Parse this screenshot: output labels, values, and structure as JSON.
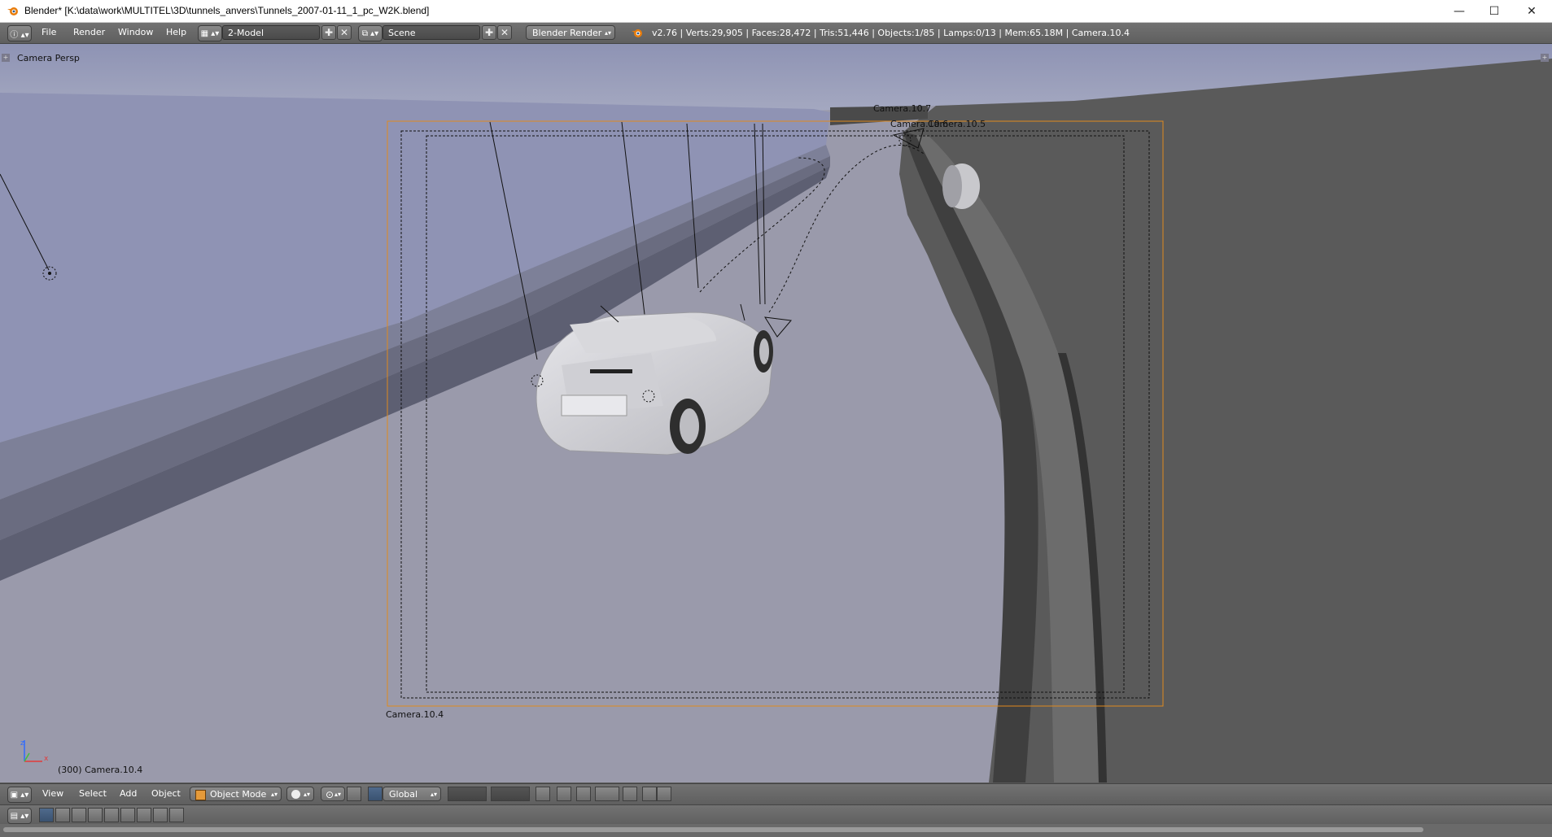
{
  "window": {
    "title": "Blender* [K:\\data\\work\\MULTITEL\\3D\\tunnels_anvers\\Tunnels_2007-01-11_1_pc_W2K.blend]",
    "controls": {
      "minimize": "—",
      "maximize": "☐",
      "close": "✕"
    }
  },
  "info_header": {
    "editor_type_icon": "info-icon",
    "menus": [
      "File",
      "Render",
      "Window",
      "Help"
    ],
    "layout": {
      "icon": "screen-layout-icon",
      "value": "2-Model"
    },
    "scene": {
      "icon": "scene-icon",
      "value": "Scene"
    },
    "render_engine": "Blender Render",
    "stats": "v2.76 | Verts:29,905 | Faces:28,472 | Tris:51,446 | Objects:1/85 | Lamps:0/13 | Mem:65.18M | Camera.10.4"
  },
  "viewport": {
    "view_name": "Camera Persp",
    "camera_labels": {
      "camera_10_7": "Camera.10.7",
      "camera_10_6": "Camera.10.6",
      "camera_10_5": "Camera.10.5",
      "camera_10_4": "Camera.10.4"
    },
    "status": "(300) Camera.10.4",
    "axis_labels": {
      "x": "x",
      "z": "z"
    },
    "colors": {
      "frame": "#e08a1e",
      "selection": "#f39c32"
    }
  },
  "view3d_header": {
    "editor_type_icon": "view3d-icon",
    "menus": [
      "View",
      "Select",
      "Add",
      "Object"
    ],
    "mode": "Object Mode",
    "pivot_icon": "pivot-icon",
    "transform_orientation": "Global"
  },
  "timeline_header": {
    "editor_type_icon": "timeline-icon"
  }
}
